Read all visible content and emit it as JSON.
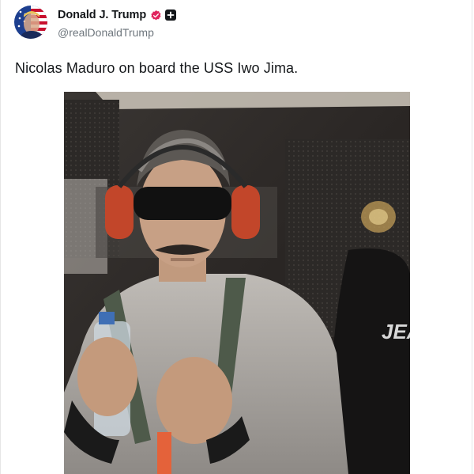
{
  "post": {
    "author": {
      "display_name": "Donald J. Trump",
      "handle": "@realDonaldTrump",
      "verified_color": "#e0245e",
      "avatar_icon": "avatar-flag-portrait",
      "badges": [
        "verified-badge-icon",
        "plus-badge-icon"
      ]
    },
    "text": "Nicolas Maduro on board the USS Iwo Jima.",
    "media": {
      "type": "photo",
      "visible_text": "JEA"
    }
  }
}
